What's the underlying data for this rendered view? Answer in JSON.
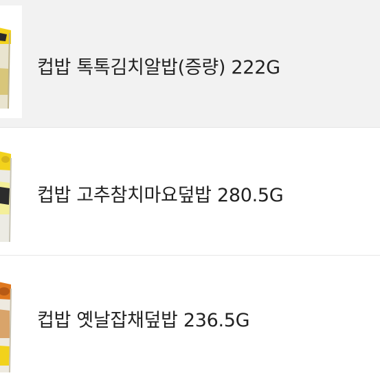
{
  "products": [
    {
      "name": "컵밥 톡톡김치알밥(증량) 222G",
      "icon": "cupbop-kimchi-cup-image"
    },
    {
      "name": "컵밥 고추참치마요덮밥 280.5G",
      "icon": "cupbop-tuna-cup-image"
    },
    {
      "name": "컵밥 옛날잡채덮밥 236.5G",
      "icon": "cupbop-japchae-cup-image"
    }
  ],
  "colors": {
    "selected_row_bg": "#f2f2f2",
    "row_bg": "#ffffff",
    "text": "#222222",
    "cup_yellow": "#f2d21c",
    "cup_orange": "#e0781e"
  }
}
